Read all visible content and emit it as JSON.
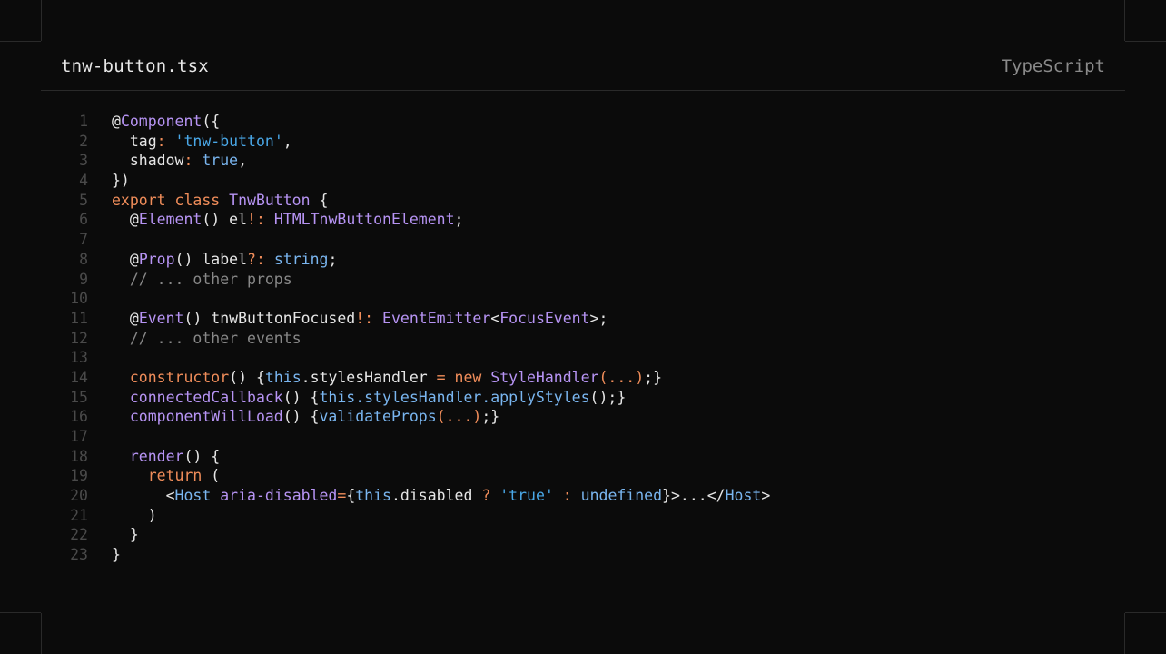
{
  "file": {
    "name": "tnw-button.tsx",
    "language": "TypeScript"
  },
  "colors": {
    "background": "#0b0b0b",
    "border": "#2a2a2a",
    "line_number": "#4a4a4a",
    "plain": "#e6e6e6",
    "keyword": "#f08d5a",
    "type": "#b794f4",
    "string": "#4aa8e8",
    "literal": "#7ab6f0",
    "comment": "#888888"
  },
  "code": {
    "lines": [
      {
        "n": "1",
        "tokens": [
          {
            "t": "@",
            "c": "plain"
          },
          {
            "t": "Component",
            "c": "type"
          },
          {
            "t": "({",
            "c": "plain"
          }
        ]
      },
      {
        "n": "2",
        "tokens": [
          {
            "t": "  tag",
            "c": "plain"
          },
          {
            "t": ": ",
            "c": "keyword"
          },
          {
            "t": "'tnw-button'",
            "c": "string"
          },
          {
            "t": ",",
            "c": "plain"
          }
        ]
      },
      {
        "n": "3",
        "tokens": [
          {
            "t": "  shadow",
            "c": "plain"
          },
          {
            "t": ": ",
            "c": "keyword"
          },
          {
            "t": "true",
            "c": "literal"
          },
          {
            "t": ",",
            "c": "plain"
          }
        ]
      },
      {
        "n": "4",
        "tokens": [
          {
            "t": "})",
            "c": "plain"
          }
        ]
      },
      {
        "n": "5",
        "tokens": [
          {
            "t": "export class ",
            "c": "keyword"
          },
          {
            "t": "TnwButton",
            "c": "type"
          },
          {
            "t": " {",
            "c": "plain"
          }
        ]
      },
      {
        "n": "6",
        "tokens": [
          {
            "t": "  @",
            "c": "plain"
          },
          {
            "t": "Element",
            "c": "type"
          },
          {
            "t": "() el",
            "c": "plain"
          },
          {
            "t": "!: ",
            "c": "keyword"
          },
          {
            "t": "HTMLTnwButtonElement",
            "c": "type"
          },
          {
            "t": ";",
            "c": "plain"
          }
        ]
      },
      {
        "n": "7",
        "tokens": []
      },
      {
        "n": "8",
        "tokens": [
          {
            "t": "  @",
            "c": "plain"
          },
          {
            "t": "Prop",
            "c": "type"
          },
          {
            "t": "() label",
            "c": "plain"
          },
          {
            "t": "?: ",
            "c": "keyword"
          },
          {
            "t": "string",
            "c": "literal"
          },
          {
            "t": ";",
            "c": "plain"
          }
        ]
      },
      {
        "n": "9",
        "tokens": [
          {
            "t": "  // ... other props",
            "c": "comment"
          }
        ]
      },
      {
        "n": "10",
        "tokens": []
      },
      {
        "n": "11",
        "tokens": [
          {
            "t": "  @",
            "c": "plain"
          },
          {
            "t": "Event",
            "c": "type"
          },
          {
            "t": "() tnwButtonFocused",
            "c": "plain"
          },
          {
            "t": "!: ",
            "c": "keyword"
          },
          {
            "t": "EventEmitter",
            "c": "type"
          },
          {
            "t": "<",
            "c": "plain"
          },
          {
            "t": "FocusEvent",
            "c": "type"
          },
          {
            "t": ">;",
            "c": "plain"
          }
        ]
      },
      {
        "n": "12",
        "tokens": [
          {
            "t": "  // ... other events",
            "c": "comment"
          }
        ]
      },
      {
        "n": "13",
        "tokens": []
      },
      {
        "n": "14",
        "tokens": [
          {
            "t": "  constructor",
            "c": "keyword"
          },
          {
            "t": "() {",
            "c": "plain"
          },
          {
            "t": "this",
            "c": "literal"
          },
          {
            "t": ".stylesHandler ",
            "c": "plain"
          },
          {
            "t": "= new ",
            "c": "keyword"
          },
          {
            "t": "StyleHandler",
            "c": "type"
          },
          {
            "t": "(...)",
            "c": "keyword"
          },
          {
            "t": ";}",
            "c": "plain"
          }
        ]
      },
      {
        "n": "15",
        "tokens": [
          {
            "t": "  connectedCallback",
            "c": "type"
          },
          {
            "t": "() {",
            "c": "plain"
          },
          {
            "t": "this.stylesHandler.applyStyles",
            "c": "literal"
          },
          {
            "t": "();}",
            "c": "plain"
          }
        ]
      },
      {
        "n": "16",
        "tokens": [
          {
            "t": "  componentWillLoad",
            "c": "type"
          },
          {
            "t": "() {",
            "c": "plain"
          },
          {
            "t": "validateProps",
            "c": "literal"
          },
          {
            "t": "(...)",
            "c": "keyword"
          },
          {
            "t": ";}",
            "c": "plain"
          }
        ]
      },
      {
        "n": "17",
        "tokens": []
      },
      {
        "n": "18",
        "tokens": [
          {
            "t": "  render",
            "c": "type"
          },
          {
            "t": "() {",
            "c": "plain"
          }
        ]
      },
      {
        "n": "19",
        "tokens": [
          {
            "t": "    return",
            "c": "keyword"
          },
          {
            "t": " (",
            "c": "plain"
          }
        ]
      },
      {
        "n": "20",
        "tokens": [
          {
            "t": "      <",
            "c": "plain"
          },
          {
            "t": "Host",
            "c": "literal"
          },
          {
            "t": " aria-disabled",
            "c": "type"
          },
          {
            "t": "=",
            "c": "keyword"
          },
          {
            "t": "{",
            "c": "plain"
          },
          {
            "t": "this",
            "c": "literal"
          },
          {
            "t": ".disabled ",
            "c": "plain"
          },
          {
            "t": "? ",
            "c": "keyword"
          },
          {
            "t": "'true'",
            "c": "string"
          },
          {
            "t": " : ",
            "c": "keyword"
          },
          {
            "t": "undefined",
            "c": "literal"
          },
          {
            "t": "}>...</",
            "c": "plain"
          },
          {
            "t": "Host",
            "c": "literal"
          },
          {
            "t": ">",
            "c": "plain"
          }
        ]
      },
      {
        "n": "21",
        "tokens": [
          {
            "t": "    )",
            "c": "plain"
          }
        ]
      },
      {
        "n": "22",
        "tokens": [
          {
            "t": "  }",
            "c": "plain"
          }
        ]
      },
      {
        "n": "23",
        "tokens": [
          {
            "t": "}",
            "c": "plain"
          }
        ]
      }
    ]
  }
}
